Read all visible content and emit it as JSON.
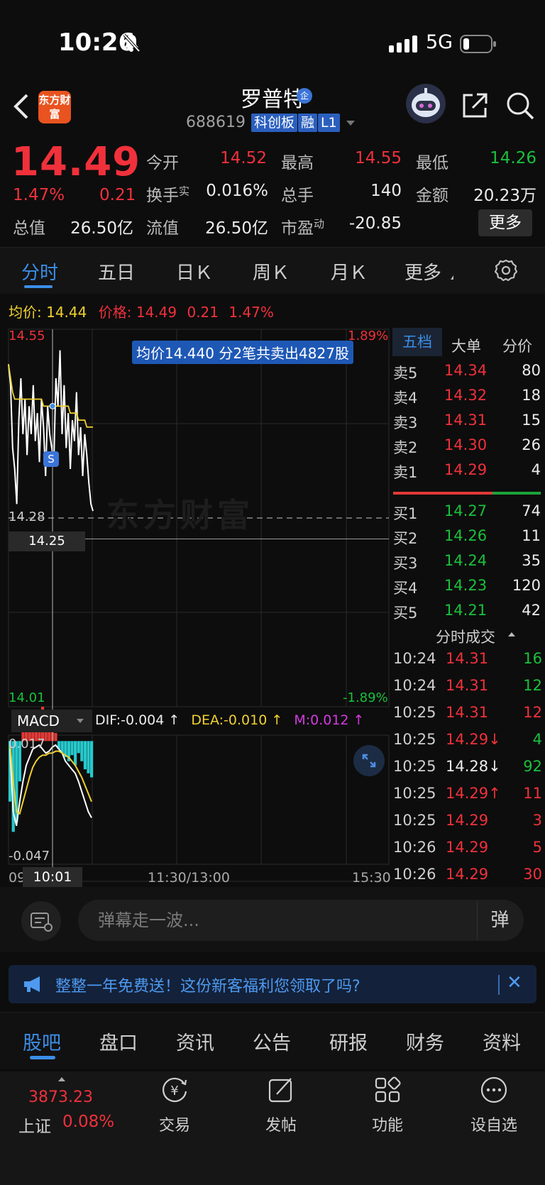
{
  "status_bar": {
    "time": "10:26",
    "network": "5G"
  },
  "header": {
    "logo_text": "东方财富",
    "stock_name": "罗普特",
    "name_badge": "企",
    "stock_code": "688619",
    "tags": [
      "科创板",
      "融",
      "L1"
    ]
  },
  "quote": {
    "price": "14.49",
    "change_pct": "1.47%",
    "change": "0.21",
    "rows": [
      [
        {
          "label": "今开",
          "value": "14.52",
          "color": "red"
        },
        {
          "label": "最高",
          "value": "14.55",
          "color": "red"
        },
        {
          "label": "最低",
          "value": "14.26",
          "color": "green"
        }
      ],
      [
        {
          "label": "换手",
          "sup": "实",
          "value": "0.016%",
          "color": "white"
        },
        {
          "label": "总手",
          "value": "140",
          "color": "white"
        },
        {
          "label": "金额",
          "value": "20.23万",
          "color": "white"
        }
      ]
    ],
    "row3": {
      "cap_label": "总值",
      "cap_value": "26.50亿",
      "float_label": "流值",
      "float_value": "26.50亿",
      "pe_label": "市盈",
      "pe_sup": "动",
      "pe_value": "-20.85"
    },
    "more_label": "更多"
  },
  "chart_tabs": [
    "分时",
    "五日",
    "日Ｋ",
    "周Ｋ",
    "月Ｋ",
    "更多"
  ],
  "avg_line": {
    "avg_label": "均价:",
    "avg_value": "14.44",
    "price_label": "价格:",
    "price_value": "14.49",
    "change": "0.21",
    "pct": "1.47%"
  },
  "chart_data": {
    "type": "line",
    "y_max_label": "14.55",
    "y_min_label": "14.01",
    "pct_max_label": "1.89%",
    "pct_min_label": "-1.89%",
    "ylim": [
      14.01,
      14.55
    ],
    "prev_close": 14.28,
    "prev_close_label": "14.28",
    "cursor_price_label": "14.25",
    "cursor_time_label": "10:01",
    "x_labels": [
      "09",
      "11:30/13:00",
      "15:30"
    ],
    "tooltip": "均价14.440  分2笔共卖出4827股",
    "watermark": "东方财富",
    "s_badge": "S",
    "series": [
      {
        "name": "价格",
        "color": "#ffffff",
        "values": [
          14.5,
          14.47,
          14.38,
          14.35,
          14.3,
          14.42,
          14.48,
          14.4,
          14.45,
          14.37,
          14.44,
          14.4,
          14.47,
          14.39,
          14.43,
          14.36,
          14.45,
          14.41,
          14.34,
          14.44,
          14.4,
          14.38,
          14.36,
          14.48,
          14.44,
          14.52,
          14.4,
          14.47,
          14.38,
          14.43,
          14.35,
          14.42,
          14.39,
          14.46,
          14.37,
          14.41,
          14.34,
          14.4,
          14.37,
          14.33,
          14.3,
          14.29
        ]
      },
      {
        "name": "均价",
        "color": "#f1d12f",
        "values": [
          14.5,
          14.48,
          14.46,
          14.45,
          14.45,
          14.45,
          14.45,
          14.45,
          14.45,
          14.45,
          14.45,
          14.45,
          14.45,
          14.45,
          14.45,
          14.45,
          14.45,
          14.44,
          14.44,
          14.44,
          14.44,
          14.44,
          14.44,
          14.44,
          14.44,
          14.44,
          14.44,
          14.44,
          14.44,
          14.44,
          14.43,
          14.43,
          14.43,
          14.43,
          14.42,
          14.42,
          14.42,
          14.42,
          14.41,
          14.41,
          14.41,
          14.41
        ]
      }
    ],
    "macd": {
      "select_label": "MACD",
      "dif": "DIF:-0.004 ↑",
      "dea": "DEA:-0.010 ↑",
      "m": "M:0.012 ↑",
      "y_max_label": "0.017",
      "y_min_label": "-0.047",
      "ylim": [
        -0.047,
        0.017
      ],
      "histogram": [
        -0.03,
        -0.045,
        -0.04,
        -0.02,
        0.005,
        0.01,
        0.013,
        0.01,
        0.012,
        0.015,
        0.017,
        0.012,
        0.008,
        0.005,
        0.004,
        -0.004,
        -0.006,
        -0.008,
        -0.01,
        -0.007,
        -0.012,
        -0.006,
        -0.01,
        -0.014,
        -0.016,
        -0.018
      ],
      "dif_values": [
        -0.004,
        -0.035,
        -0.042,
        -0.03,
        -0.02,
        -0.012,
        -0.008,
        -0.004,
        -0.003,
        -0.002,
        -0.004,
        -0.006,
        -0.005,
        -0.003,
        -0.002,
        -0.004,
        -0.006,
        -0.01,
        -0.012,
        -0.014,
        -0.016,
        -0.02,
        -0.025,
        -0.03,
        -0.035,
        -0.038
      ],
      "dea_values": [
        -0.002,
        -0.02,
        -0.035,
        -0.036,
        -0.03,
        -0.024,
        -0.018,
        -0.013,
        -0.01,
        -0.008,
        -0.007,
        -0.007,
        -0.006,
        -0.006,
        -0.005,
        -0.005,
        -0.006,
        -0.007,
        -0.008,
        -0.01,
        -0.012,
        -0.015,
        -0.018,
        -0.022,
        -0.026,
        -0.03
      ]
    }
  },
  "order_book": {
    "tabs": [
      "五档",
      "大单",
      "分价"
    ],
    "asks": [
      {
        "label": "卖5",
        "price": "14.34",
        "vol": "80"
      },
      {
        "label": "卖4",
        "price": "14.32",
        "vol": "18"
      },
      {
        "label": "卖3",
        "price": "14.31",
        "vol": "15"
      },
      {
        "label": "卖2",
        "price": "14.30",
        "vol": "26"
      },
      {
        "label": "卖1",
        "price": "14.29",
        "vol": "4"
      }
    ],
    "bids": [
      {
        "label": "买1",
        "price": "14.27",
        "vol": "74"
      },
      {
        "label": "买2",
        "price": "14.26",
        "vol": "11"
      },
      {
        "label": "买3",
        "price": "14.24",
        "vol": "35"
      },
      {
        "label": "买4",
        "price": "14.23",
        "vol": "120"
      },
      {
        "label": "买5",
        "price": "14.21",
        "vol": "42"
      }
    ],
    "trades_title": "分时成交",
    "trades": [
      {
        "time": "10:24",
        "price": "14.31",
        "price_color": "red",
        "vol": "16",
        "vol_color": "green"
      },
      {
        "time": "10:24",
        "price": "14.31",
        "price_color": "red",
        "vol": "12",
        "vol_color": "green"
      },
      {
        "time": "10:25",
        "price": "14.31",
        "price_color": "red",
        "vol": "12",
        "vol_color": "red"
      },
      {
        "time": "10:25",
        "price": "14.29↓",
        "price_color": "red",
        "vol": "4",
        "vol_color": "green"
      },
      {
        "time": "10:25",
        "price": "14.28↓",
        "price_color": "white",
        "vol": "92",
        "vol_color": "green"
      },
      {
        "time": "10:25",
        "price": "14.29↑",
        "price_color": "red",
        "vol": "11",
        "vol_color": "red"
      },
      {
        "time": "10:25",
        "price": "14.29",
        "price_color": "red",
        "vol": "3",
        "vol_color": "red"
      },
      {
        "time": "10:26",
        "price": "14.29",
        "price_color": "red",
        "vol": "5",
        "vol_color": "red"
      },
      {
        "time": "10:26",
        "price": "14.29",
        "price_color": "red",
        "vol": "30",
        "vol_color": "red"
      }
    ]
  },
  "danmaku": {
    "placeholder": "弹幕走一波...",
    "send_label": "弹"
  },
  "promo": {
    "text": "整整一年免费送！这份新客福利您领取了吗?",
    "close": "✕"
  },
  "bottom_tabs": [
    "股吧",
    "盘口",
    "资讯",
    "公告",
    "研报",
    "财务",
    "资料"
  ],
  "bottom_nav": {
    "index_value": "3873.23",
    "index_name": "上证",
    "index_pct": "0.08%",
    "items": [
      {
        "label": "交易",
        "icon": "trade-icon"
      },
      {
        "label": "发帖",
        "icon": "post-icon"
      },
      {
        "label": "功能",
        "icon": "functions-icon"
      },
      {
        "label": "设自选",
        "icon": "watchlist-icon"
      }
    ]
  }
}
